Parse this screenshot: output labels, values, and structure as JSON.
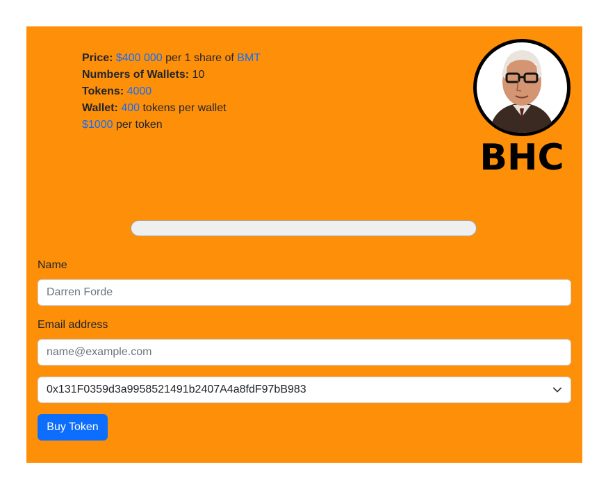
{
  "info": {
    "price_label": "Price:",
    "price_value": "$400 000",
    "price_mid": "per 1 share of",
    "price_asset": "BMT",
    "wallets_label": "Numbers of Wallets:",
    "wallets_value": "10",
    "tokens_label": "Tokens:",
    "tokens_value": "4000",
    "wallet_label": "Wallet:",
    "wallet_value": "400",
    "wallet_suffix": "tokens per wallet",
    "token_price": "$1000",
    "token_price_suffix": "per token"
  },
  "logo": {
    "text": "BHC"
  },
  "progress": {
    "value": 0
  },
  "form": {
    "name_label": "Name",
    "name_placeholder": "Darren Forde",
    "email_label": "Email address",
    "email_placeholder": "name@example.com",
    "wallet_selected": "0x131F0359d3a9958521491b2407A4a8fdF97bB983",
    "submit_label": "Buy Token"
  },
  "colors": {
    "card_bg": "#fe8f09",
    "link": "#0d6efd",
    "button": "#0d6efd"
  }
}
